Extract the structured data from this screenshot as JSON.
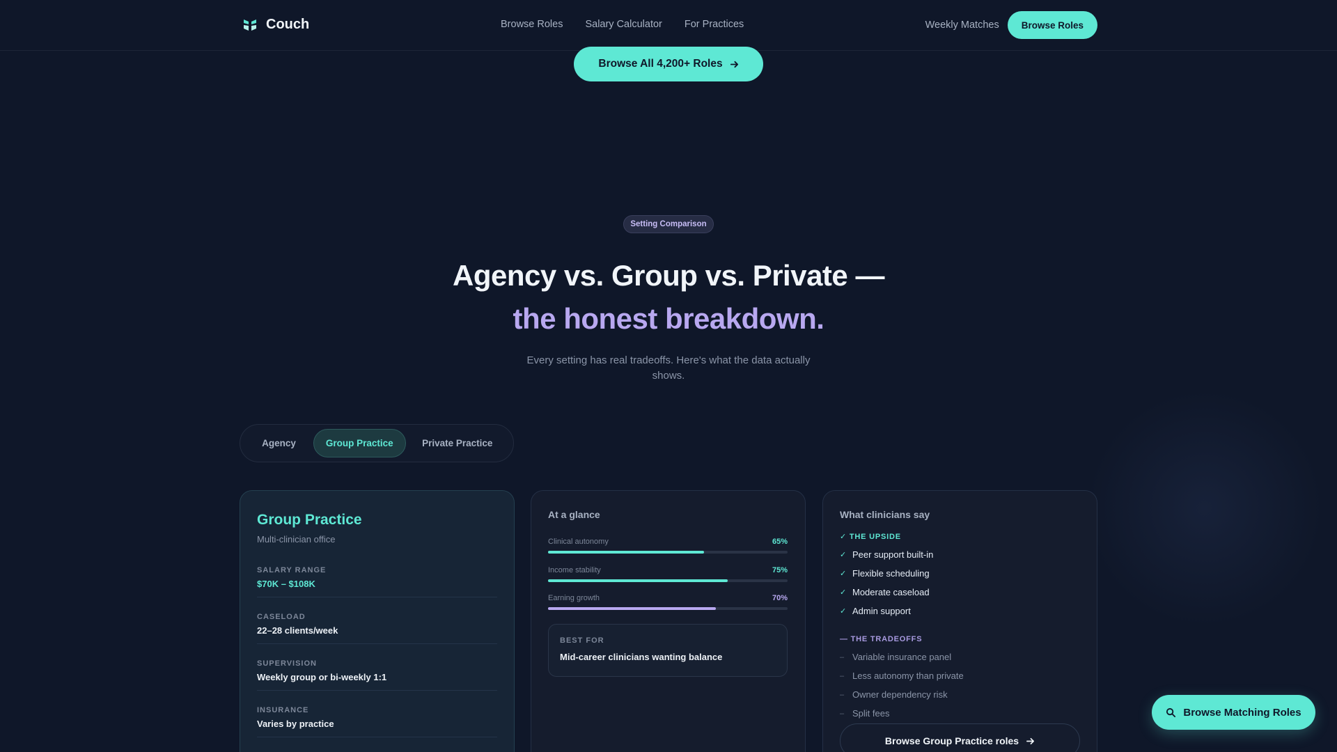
{
  "nav": {
    "brand": "Couch",
    "links": [
      "Browse Roles",
      "Salary Calculator",
      "For Practices"
    ],
    "weekly": "Weekly Matches",
    "cta": "Browse Roles"
  },
  "top_cta": "Browse All 4,200+ Roles",
  "hero": {
    "badge": "Setting Comparison",
    "title_line1": "Agency vs. Group vs. Private —",
    "title_line2": "the honest breakdown.",
    "subtitle": "Every setting has real tradeoffs. Here's what the data actually shows."
  },
  "tabs": [
    "Agency",
    "Group Practice",
    "Private Practice"
  ],
  "active_tab": "Group Practice",
  "overview": {
    "title": "Group Practice",
    "subtitle": "Multi-clinician office",
    "fields": [
      {
        "label": "SALARY RANGE",
        "value": "$70K – $108K"
      },
      {
        "label": "CASELOAD",
        "value": "22–28 clients/week"
      },
      {
        "label": "SUPERVISION",
        "value": "Weekly group or bi-weekly 1:1"
      },
      {
        "label": "INSURANCE",
        "value": "Varies by practice"
      }
    ]
  },
  "glance": {
    "heading": "At a glance",
    "metrics": [
      {
        "label": "Clinical autonomy",
        "pct": "65%",
        "value": 65
      },
      {
        "label": "Income stability",
        "pct": "75%",
        "value": 75
      },
      {
        "label": "Earning growth",
        "pct": "70%",
        "value": 70
      }
    ],
    "best_for_label": "BEST FOR",
    "best_for_value": "Mid-career clinicians wanting balance"
  },
  "clinicians": {
    "heading": "What clinicians say",
    "upside_label": "✓ THE UPSIDE",
    "upside": [
      "Peer support built-in",
      "Flexible scheduling",
      "Moderate caseload",
      "Admin support"
    ],
    "tradeoffs_label": "— THE TRADEOFFS",
    "tradeoffs": [
      "Variable insurance panel",
      "Less autonomy than private",
      "Owner dependency risk",
      "Split fees"
    ],
    "cta": "Browse Group Practice roles"
  },
  "fab": "Browse Matching Roles",
  "colors": {
    "background": "#0f1729",
    "accent_teal": "#5ee8d4",
    "accent_violet": "#b8a8f0"
  }
}
